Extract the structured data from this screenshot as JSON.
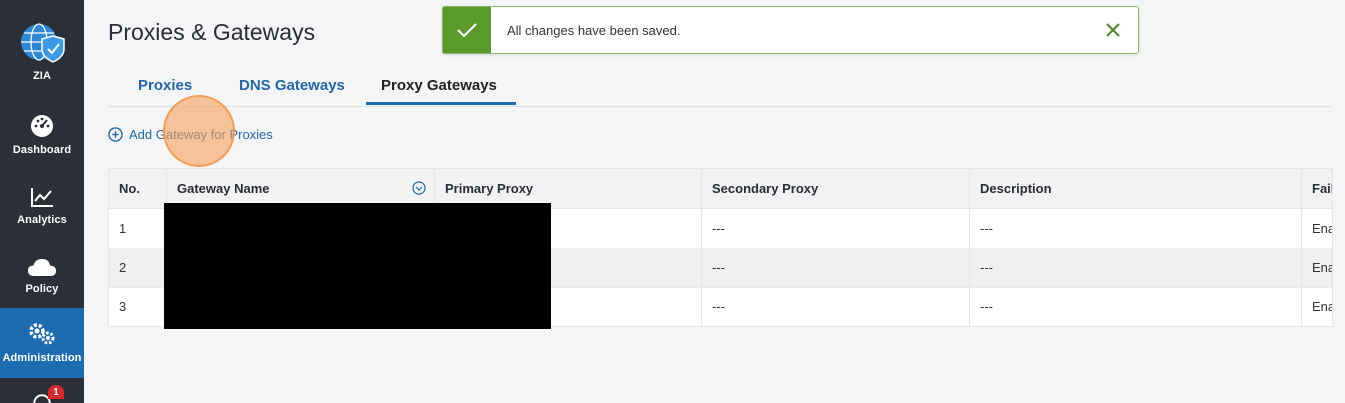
{
  "sidebar": {
    "items": [
      {
        "label": "ZIA",
        "icon": "globe-shield-icon"
      },
      {
        "label": "Dashboard",
        "icon": "dashboard-gauge-icon"
      },
      {
        "label": "Analytics",
        "icon": "analytics-chart-icon"
      },
      {
        "label": "Policy",
        "icon": "cloud-icon"
      },
      {
        "label": "Administration",
        "icon": "gears-icon",
        "active": true
      },
      {
        "label": "",
        "icon": "notifications-icon",
        "badge": "1"
      }
    ]
  },
  "page": {
    "title": "Proxies & Gateways"
  },
  "tabs": [
    {
      "label": "Proxies"
    },
    {
      "label": "DNS Gateways"
    },
    {
      "label": "Proxy Gateways",
      "active": true
    }
  ],
  "actions": {
    "add_label": "Add Gateway for Proxies"
  },
  "table": {
    "columns": [
      "No.",
      "Gateway Name",
      "Primary Proxy",
      "Secondary Proxy",
      "Description",
      "Fail"
    ],
    "rows": [
      {
        "no": "1",
        "secondary": "---",
        "description": "---",
        "fail": "Ena"
      },
      {
        "no": "2",
        "secondary": "---",
        "description": "---",
        "fail": "Ena"
      },
      {
        "no": "3",
        "secondary": "---",
        "description": "---",
        "fail": "Ena"
      }
    ]
  },
  "toast": {
    "message": "All changes have been saved.",
    "status_color": "#5a9a2a"
  },
  "colors": {
    "accent": "#1e6cb0",
    "sidebar_bg": "#2b2f38",
    "link": "#2467a6"
  }
}
